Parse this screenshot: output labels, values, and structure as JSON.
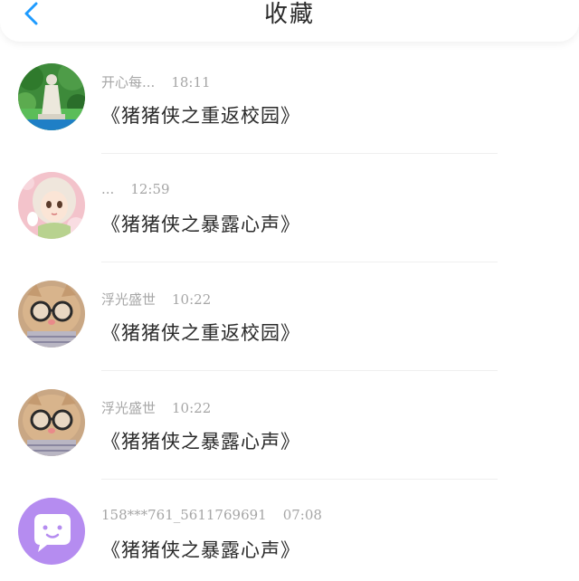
{
  "header": {
    "title": "收藏",
    "back_icon": "chevron-left-icon",
    "accent_color": "#1e9bff"
  },
  "favorites": [
    {
      "username": "开心每...",
      "time": "18:11",
      "title": "《猪猪侠之重返校园》",
      "avatar": "statue-photo"
    },
    {
      "username": "...",
      "time": "12:59",
      "title": "《猪猪侠之暴露心声》",
      "avatar": "cartoon-girl"
    },
    {
      "username": "浮光盛世",
      "time": "10:22",
      "title": "《猪猪侠之重返校园》",
      "avatar": "cat-with-glasses"
    },
    {
      "username": "浮光盛世",
      "time": "10:22",
      "title": "《猪猪侠之暴露心声》",
      "avatar": "cat-with-glasses"
    },
    {
      "username": "158***761_5611769691",
      "time": "07:08",
      "title": "《猪猪侠之暴露心声》",
      "avatar": "default-purple-chat"
    }
  ]
}
